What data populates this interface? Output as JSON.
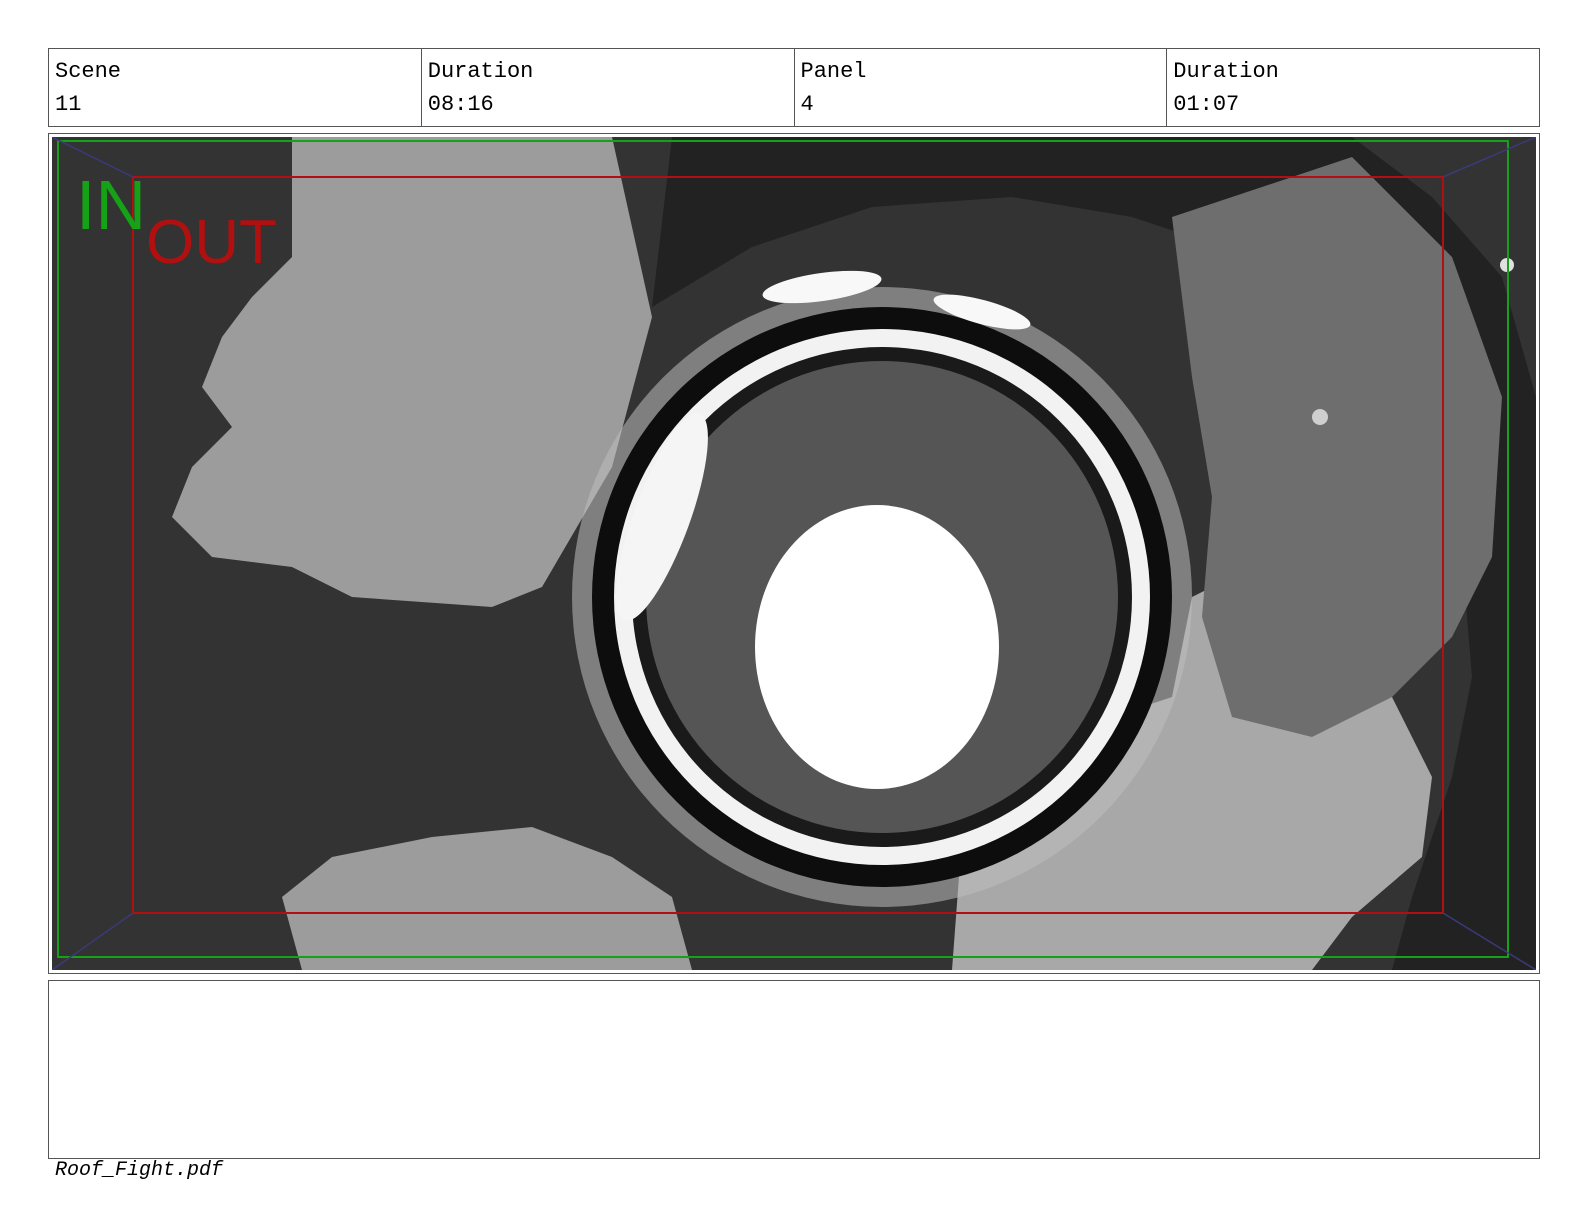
{
  "header": {
    "scene_label": "Scene",
    "scene_value": "11",
    "scene_duration_label": "Duration",
    "scene_duration_value": "08:16",
    "panel_label": "Panel",
    "panel_value": "4",
    "panel_duration_label": "Duration",
    "panel_duration_value": "01:07"
  },
  "panel": {
    "in_marker": "IN",
    "out_marker": "OUT",
    "in_color": "#16a216",
    "out_color": "#b01010"
  },
  "action_notes": "",
  "footer": {
    "filename": "Roof_Fight.pdf"
  }
}
